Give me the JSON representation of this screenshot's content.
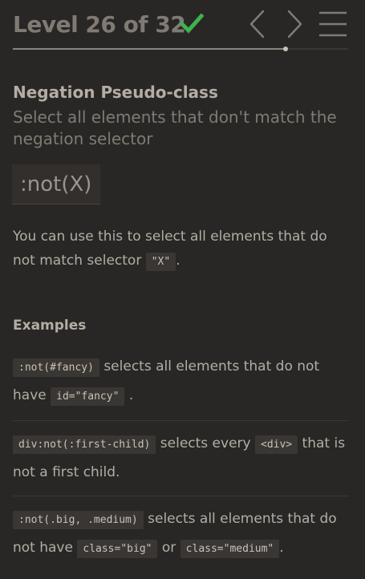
{
  "header": {
    "level_prefix": "Level",
    "level_current": "26",
    "level_of": "of",
    "level_total": "32",
    "completed": true,
    "progress_fraction": 0.8125,
    "icons": {
      "check": "check-icon",
      "prev": "chevron-left-icon",
      "next": "chevron-right-icon",
      "menu": "hamburger-menu-icon"
    },
    "colors": {
      "check": "#3fb24e",
      "nav": "#807a74"
    }
  },
  "lesson": {
    "name": "Negation Pseudo-class",
    "hint": "Select all elements that don't match the negation selector",
    "selector": ":not(X)",
    "description_before": "You can use this to select all elements that do not match selector",
    "description_code": "\"X\"",
    "description_after": "."
  },
  "examples": {
    "title": "Examples",
    "items": [
      {
        "code1": ":not(#fancy)",
        "text1": "selects all elements that do not have",
        "code2": "id=\"fancy\"",
        "text2": ".",
        "code3": "",
        "text3": ""
      },
      {
        "code1": "div:not(:first-child)",
        "text1": "selects every",
        "code2": "<div>",
        "text2": "that is not a first child.",
        "code3": "",
        "text3": ""
      },
      {
        "code1": ":not(.big, .medium)",
        "text1": "selects all elements that do not have",
        "code2": "class=\"big\"",
        "text2": "or",
        "code3": "class=\"medium\"",
        "text3": "."
      }
    ]
  }
}
